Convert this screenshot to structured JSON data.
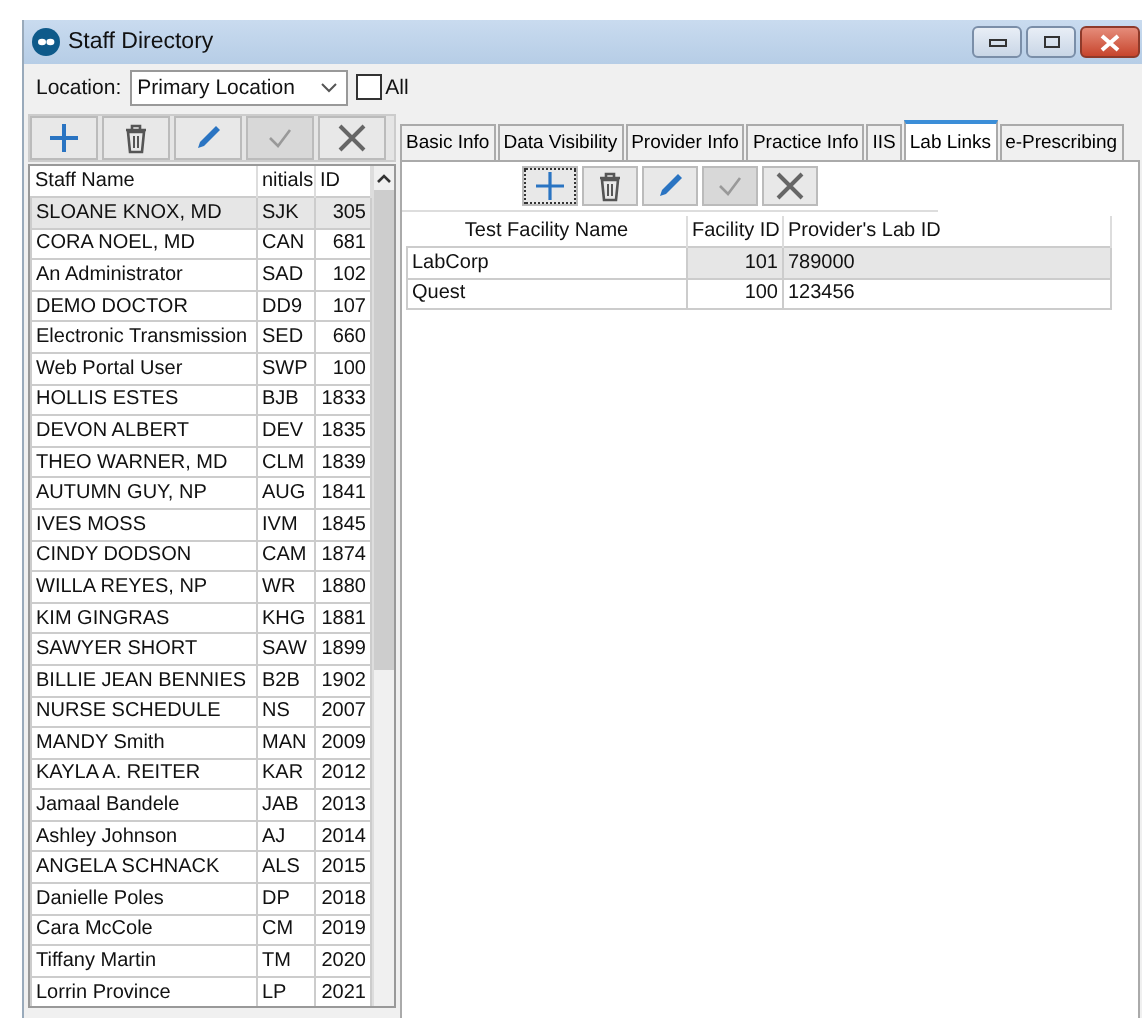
{
  "window": {
    "title": "Staff Directory"
  },
  "location": {
    "label": "Location:",
    "value": "Primary Location",
    "all_label": "All",
    "all_checked": false
  },
  "left_toolbar": [
    {
      "kind": "add",
      "disabled": false,
      "focused": false
    },
    {
      "kind": "delete",
      "disabled": false,
      "focused": false
    },
    {
      "kind": "edit",
      "disabled": false,
      "focused": false
    },
    {
      "kind": "save",
      "disabled": true,
      "focused": false
    },
    {
      "kind": "cancel",
      "disabled": false,
      "focused": false
    }
  ],
  "staff_table": {
    "columns": [
      "Staff Name",
      "nitials",
      "ID"
    ],
    "rows": [
      {
        "cells": [
          "SLOANE KNOX, MD",
          "SJK",
          "305"
        ],
        "selected": true
      },
      {
        "cells": [
          "CORA NOEL, MD",
          "CAN",
          "681"
        ],
        "selected": false
      },
      {
        "cells": [
          "An Administrator",
          "SAD",
          "102"
        ],
        "selected": false
      },
      {
        "cells": [
          "DEMO DOCTOR",
          "DD9",
          "107"
        ],
        "selected": false
      },
      {
        "cells": [
          "Electronic Transmission",
          "SED",
          "660"
        ],
        "selected": false
      },
      {
        "cells": [
          "Web Portal User",
          "SWP",
          "100"
        ],
        "selected": false
      },
      {
        "cells": [
          "HOLLIS ESTES",
          "BJB",
          "1833"
        ],
        "selected": false
      },
      {
        "cells": [
          "DEVON ALBERT",
          "DEV",
          "1835"
        ],
        "selected": false
      },
      {
        "cells": [
          "THEO WARNER, MD",
          "CLM",
          "1839"
        ],
        "selected": false
      },
      {
        "cells": [
          "AUTUMN GUY, NP",
          "AUG",
          "1841"
        ],
        "selected": false
      },
      {
        "cells": [
          "IVES MOSS",
          "IVM",
          "1845"
        ],
        "selected": false
      },
      {
        "cells": [
          "CINDY DODSON",
          "CAM",
          "1874"
        ],
        "selected": false
      },
      {
        "cells": [
          "WILLA REYES, NP",
          "WR",
          "1880"
        ],
        "selected": false
      },
      {
        "cells": [
          "KIM GINGRAS",
          "KHG",
          "1881"
        ],
        "selected": false
      },
      {
        "cells": [
          "SAWYER SHORT",
          "SAW",
          "1899"
        ],
        "selected": false
      },
      {
        "cells": [
          "BILLIE JEAN BENNIES",
          "B2B",
          "1902"
        ],
        "selected": false
      },
      {
        "cells": [
          "NURSE SCHEDULE",
          "NS",
          "2007"
        ],
        "selected": false
      },
      {
        "cells": [
          "MANDY Smith",
          "MAN",
          "2009"
        ],
        "selected": false
      },
      {
        "cells": [
          "KAYLA A. REITER",
          "KAR",
          "2012"
        ],
        "selected": false
      },
      {
        "cells": [
          "Jamaal Bandele",
          "JAB",
          "2013"
        ],
        "selected": false
      },
      {
        "cells": [
          "Ashley Johnson",
          "AJ",
          "2014"
        ],
        "selected": false
      },
      {
        "cells": [
          "ANGELA SCHNACK",
          "ALS",
          "2015"
        ],
        "selected": false
      },
      {
        "cells": [
          "Danielle Poles",
          "DP",
          "2018"
        ],
        "selected": false
      },
      {
        "cells": [
          "Cara McCole",
          "CM",
          "2019"
        ],
        "selected": false
      },
      {
        "cells": [
          "Tiffany Martin",
          "TM",
          "2020"
        ],
        "selected": false
      },
      {
        "cells": [
          "Lorrin Province",
          "LP",
          "2021"
        ],
        "selected": false
      }
    ]
  },
  "tabs": [
    {
      "label": "Basic Info",
      "selected": false
    },
    {
      "label": "Data Visibility",
      "selected": false
    },
    {
      "label": "Provider Info",
      "selected": false
    },
    {
      "label": "Practice Info",
      "selected": false
    },
    {
      "label": "IIS",
      "selected": false
    },
    {
      "label": "Lab Links",
      "selected": true
    },
    {
      "label": "e-Prescribing",
      "selected": false
    }
  ],
  "lab_toolbar": [
    {
      "kind": "add",
      "disabled": false,
      "focused": true
    },
    {
      "kind": "delete",
      "disabled": false,
      "focused": false
    },
    {
      "kind": "edit",
      "disabled": false,
      "focused": false
    },
    {
      "kind": "save",
      "disabled": true,
      "focused": false
    },
    {
      "kind": "cancel",
      "disabled": false,
      "focused": false
    }
  ],
  "lab_table": {
    "columns": [
      "Test Facility Name",
      "Facility ID",
      "Provider's Lab ID"
    ],
    "rows": [
      {
        "cells": [
          "LabCorp",
          "101",
          "789000"
        ],
        "selected": true
      },
      {
        "cells": [
          "Quest",
          "100",
          "123456"
        ],
        "selected": false
      }
    ]
  }
}
